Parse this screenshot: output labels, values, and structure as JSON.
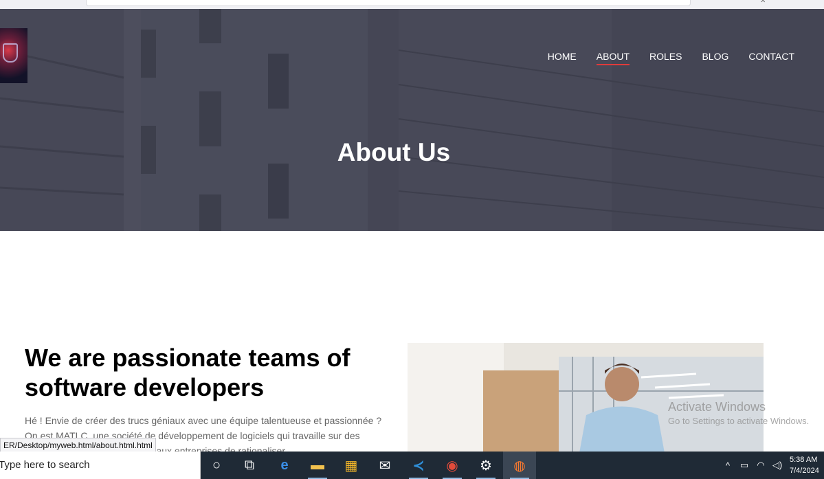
{
  "site": {
    "nav": [
      {
        "label": "HOME",
        "active": false
      },
      {
        "label": "ABOUT",
        "active": true
      },
      {
        "label": "ROLES",
        "active": false
      },
      {
        "label": "BLOG",
        "active": false
      },
      {
        "label": "CONTACT",
        "active": false
      }
    ],
    "hero_title": "About Us",
    "about": {
      "heading": "We are passionate teams of software developers",
      "text": "Hé ! Envie de créer des trucs géniaux avec une équipe talentueuse et passionnée ? On est MATLC, une société de développement de logiciels qui travaille sur des solutions de pointe permettant aux entreprises de rationaliser"
    },
    "accent_color": "#e03b3b"
  },
  "browser": {
    "status_url": "ER/Desktop/myweb.html/about.html.html",
    "close_glyph": "✕"
  },
  "windows": {
    "activate_title": "Activate Windows",
    "activate_subtitle": "Go to Settings to activate Windows.",
    "search_placeholder": "Type here to search",
    "apps": [
      {
        "name": "cortana-icon",
        "glyph": "○"
      },
      {
        "name": "task-view-icon",
        "glyph": "⧉"
      },
      {
        "name": "edge-icon",
        "glyph": "e"
      },
      {
        "name": "file-explorer-icon",
        "glyph": "▬"
      },
      {
        "name": "store-icon",
        "glyph": "▦"
      },
      {
        "name": "mail-icon",
        "glyph": "✉"
      },
      {
        "name": "vscode-icon",
        "glyph": "≺"
      },
      {
        "name": "chrome-icon",
        "glyph": "◉"
      },
      {
        "name": "settings-icon",
        "glyph": "⚙"
      },
      {
        "name": "firefox-icon",
        "glyph": "◍"
      }
    ],
    "tray": {
      "chevron": "^",
      "battery": "▭",
      "wifi": "◠",
      "volume": "◁)"
    },
    "time": "5:38 AM",
    "date": "7/4/2024"
  }
}
